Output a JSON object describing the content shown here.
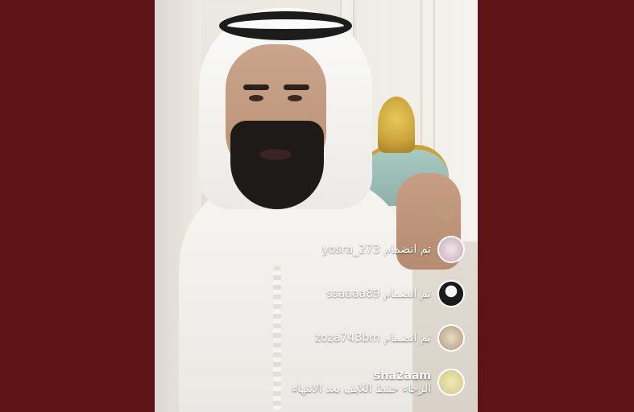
{
  "comments": [
    {
      "text": "تم انضمام yosra_273",
      "avatar_icon": "user-avatar-icon"
    },
    {
      "text": "تم انضمام ssaaaa89",
      "avatar_icon": "user-avatar-icon"
    },
    {
      "text": "تم انضمام zoza743bm",
      "avatar_icon": "user-avatar-icon"
    }
  ],
  "message": {
    "username": "sha2aam",
    "text": "الرجاء حفظ اللايف بعد الانتهاء",
    "avatar_icon": "user-avatar-icon"
  },
  "colors": {
    "background": "#5e1416",
    "comment_text": "#ffffff"
  }
}
